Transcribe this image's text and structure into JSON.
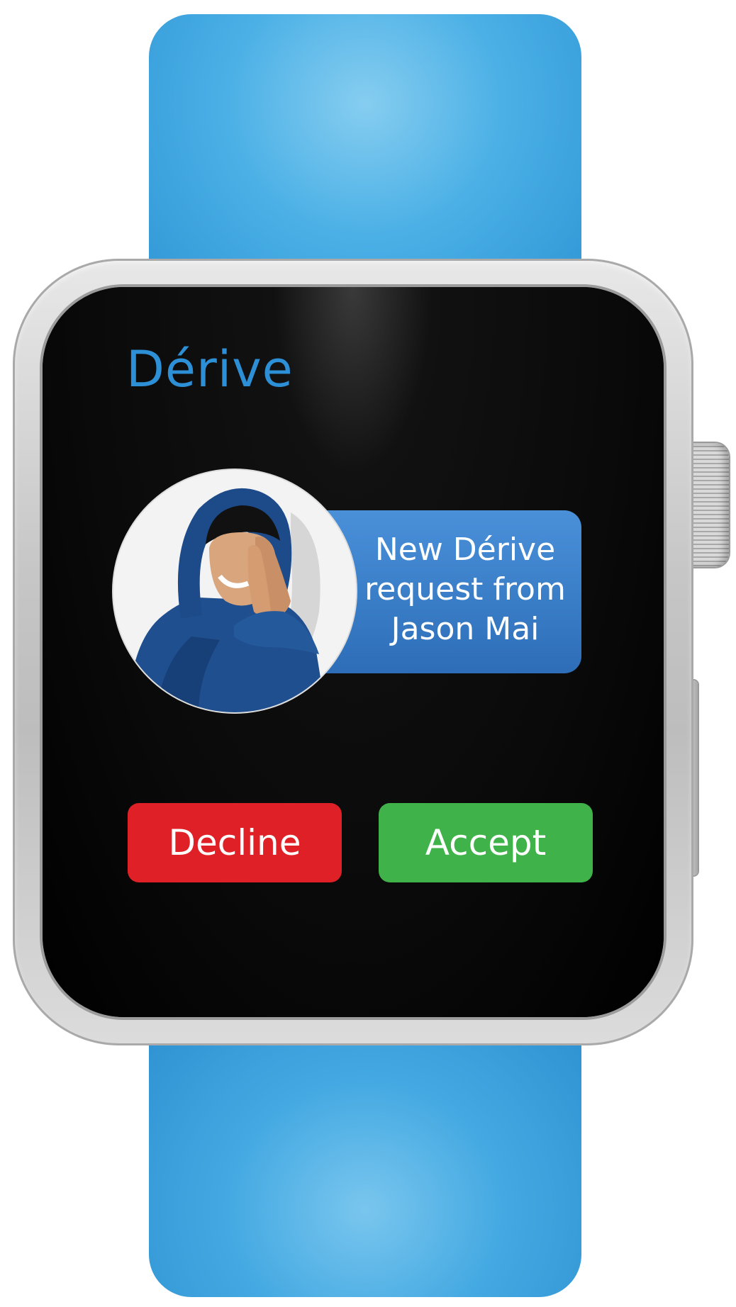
{
  "app": {
    "title": "Dérive"
  },
  "notification": {
    "message": "New Dérive request from Jason Mai",
    "message_lines": [
      "New Dérive",
      "request from",
      "Jason Mai"
    ],
    "avatar_icon": "person-avatar-photo"
  },
  "actions": {
    "decline_label": "Decline",
    "accept_label": "Accept"
  },
  "colors": {
    "title": "#2d8fd6",
    "bubble": "#3b7fc9",
    "decline": "#e02027",
    "accept": "#3fb34a",
    "strap": "#4bb0e6"
  }
}
